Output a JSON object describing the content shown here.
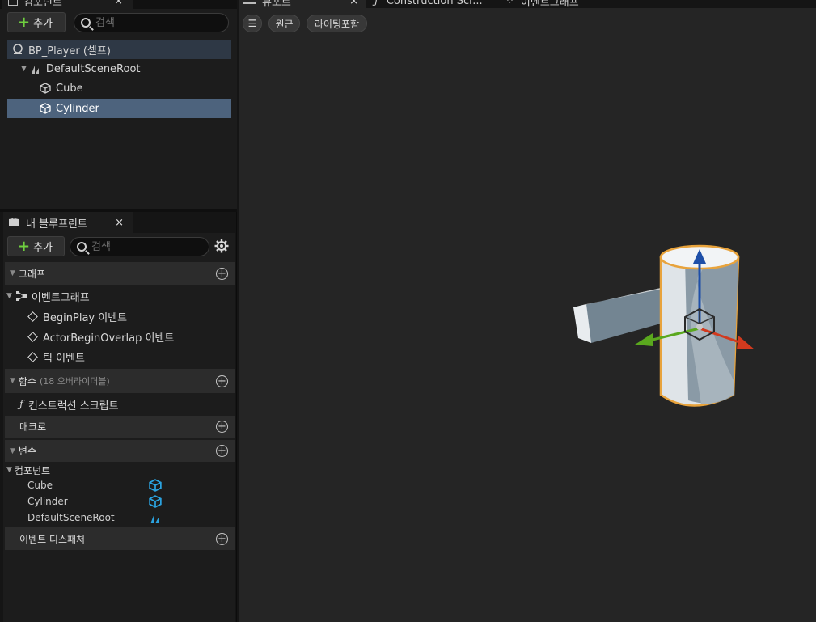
{
  "components_panel": {
    "tab_label": "컴포넌트",
    "close": "×",
    "add_label": "추가",
    "search_placeholder": "검색",
    "tree": [
      {
        "label": "BP_Player (셀프)"
      },
      {
        "label": "DefaultSceneRoot"
      },
      {
        "label": "Cube"
      },
      {
        "label": "Cylinder"
      }
    ]
  },
  "blueprint_panel": {
    "tab_label": "내 블루프린트",
    "close": "×",
    "add_label": "추가",
    "search_placeholder": "검색",
    "graph_section": "그래프",
    "event_graph": "이벤트그래프",
    "events": [
      "BeginPlay 이벤트",
      "ActorBeginOverlap 이벤트",
      "틱 이벤트"
    ],
    "functions_section": "함수",
    "functions_override": "(18 오버라이더블)",
    "construction_script": "컨스트럭션 스크립트",
    "macros_section": "매크로",
    "variables_section": "변수",
    "components_category": "컴포넌트",
    "variables": [
      "Cube",
      "Cylinder",
      "DefaultSceneRoot"
    ],
    "dispatchers_section": "이벤트 디스패처"
  },
  "viewport": {
    "tabs": [
      {
        "label": "뷰포트",
        "active": true
      },
      {
        "label": "Construction Scr..."
      },
      {
        "label": "이벤트그래프"
      }
    ],
    "close": "×",
    "menu_icon": "☰",
    "perspective_label": "원근",
    "lit_label": "라이팅포함"
  },
  "colors": {
    "selection": "#4d637d",
    "accent_add": "#6fcf3f",
    "outline": "#e8a33c",
    "gizmo_x": "#d23a1e",
    "gizmo_y": "#5aa81e",
    "gizmo_z": "#1e4fa8"
  }
}
